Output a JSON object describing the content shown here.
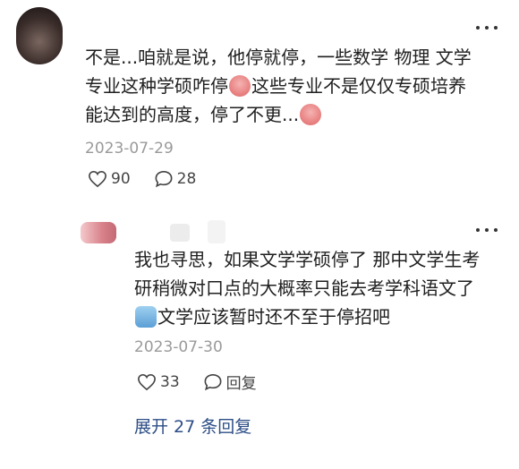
{
  "comments": [
    {
      "text_segments": [
        "不是...咱就是说，他停就停，一些数学 物理 文学",
        "专业这种学硕咋停",
        "这些专业不是仅仅专硕培养",
        "能达到的高度，停了不更...",
        ""
      ],
      "date": "2023-07-29",
      "like_count": "90",
      "reply_count": "28"
    },
    {
      "text_segments": [
        "我也寻思，如果文学学硕停了 那中文学生考",
        "研稍微对口点的大概率只能去考学科语文了",
        "文学应该暂时还不至于停招吧"
      ],
      "date": "2023-07-30",
      "like_count": "33",
      "reply_label": "回复"
    }
  ],
  "expand_replies": "展开 27 条回复",
  "icons": [
    "heart-icon",
    "comment-icon",
    "more-icon",
    "crying-emoji-icon",
    "sweat-emoji-icon"
  ]
}
